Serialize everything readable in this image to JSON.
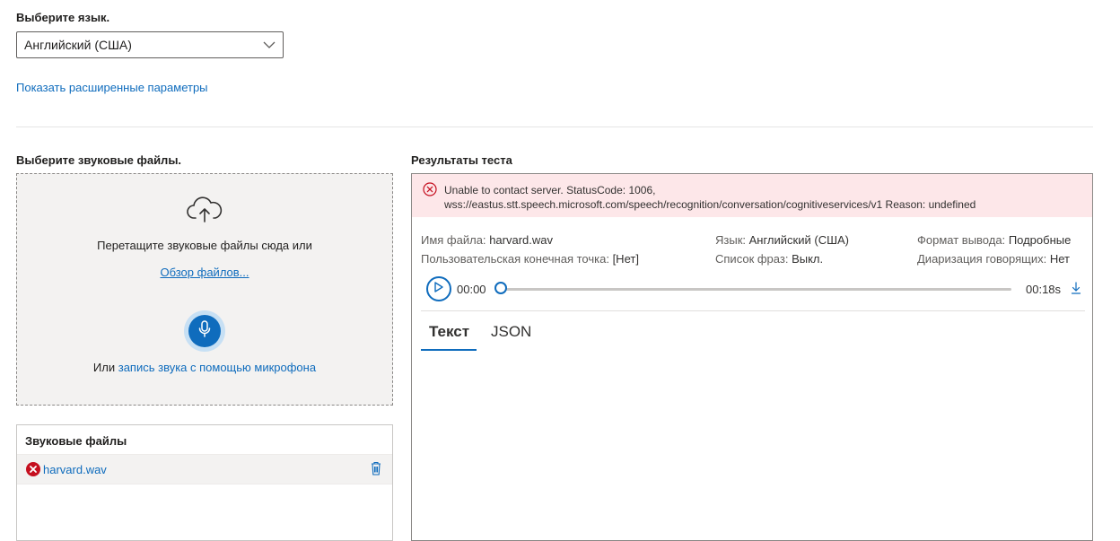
{
  "language": {
    "label": "Выберите язык.",
    "selected": "Английский (США)",
    "advanced_link": "Показать расширенные параметры"
  },
  "upload": {
    "label": "Выберите звуковые файлы.",
    "drag_text": "Перетащите звуковые файлы сюда или",
    "browse_link": "Обзор файлов...",
    "or_text": "Или",
    "record_link": "запись звука с помощью микрофона"
  },
  "audio_files": {
    "title": "Звуковые файлы",
    "items": [
      {
        "name": "harvard.wav",
        "status": "error"
      }
    ]
  },
  "results": {
    "title": "Результаты теста",
    "error_line1": "Unable to contact server. StatusCode: 1006,",
    "error_line2": "wss://eastus.stt.speech.microsoft.com/speech/recognition/conversation/cognitiveservices/v1 Reason: undefined",
    "file_name_key": "Имя файла:",
    "file_name_val": "harvard.wav",
    "endpoint_key": "Пользовательская конечная точка:",
    "endpoint_val": "[Нет]",
    "lang_key": "Язык:",
    "lang_val": "Английский (США)",
    "phrases_key": "Список фраз:",
    "phrases_val": "Выкл.",
    "format_key": "Формат вывода:",
    "format_val": "Подробные",
    "diar_key": "Диаризация говорящих:",
    "diar_val": "Нет",
    "player": {
      "current": "00:00",
      "duration": "00:18s",
      "progress": 0
    },
    "tabs": [
      "Текст",
      "JSON"
    ],
    "active_tab": 0
  },
  "colors": {
    "accent": "#0f6cbd",
    "error_bg": "#fde7e9",
    "error_icon": "#c50f1f"
  }
}
